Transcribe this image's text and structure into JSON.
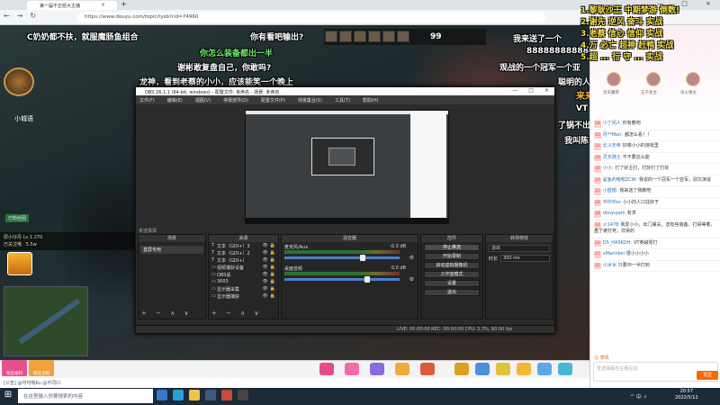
{
  "browser": {
    "tab_title": "第一届不正经大主播",
    "url": "https://www.douyu.com/topic/tysb?rid=74960",
    "tab_close": "×",
    "new_tab": "+",
    "win_controls": [
      "—",
      "□",
      "×"
    ],
    "nav_icons": [
      "←",
      "→",
      "↻"
    ]
  },
  "stream": {
    "hud_score": "99",
    "portrait_name": "小城语",
    "left_info_1": "原小仔丹 Lv 1 270",
    "left_info_2": "已关注哦 · 5.5w",
    "left_badge": "已粉丝团"
  },
  "danmaku": {
    "d1": "C奶奶都不扶，就服魔肠鱼组合",
    "d2": "你有看吧输出?",
    "d3": "你怎么装备都出一半",
    "d4": "谢彬敢复盘自己，你敢吗?",
    "d5": "龙神，看到老蔡的小小，应该能笑一个晚上",
    "d6": "我来送了一个",
    "d7": "888888888888 88",
    "d8": "观战的一个冠军一个亚",
    "d9": "聪明的人",
    "d10": "来来",
    "d11": "VT",
    "d12": "了锅不出",
    "d13": "我叫陈",
    "r1": "1.黎耿沙王 中期梦游 倒数!",
    "r2": "2.谢先 逆风 奋斗 实战",
    "r3": "3.老蔡 信心 信仰 实战",
    "r4": "4.万 必亡 超神 赶鸭 实战",
    "r5": "5.超 ... 行 守 ... 实战"
  },
  "obs": {
    "title": "OBS 26.1.1 (64-bit, windows) - 配置文件: 未命名 - 场景: 未命名",
    "menu": [
      "文件(F)",
      "编辑(E)",
      "视图(V)",
      "停靠部件(D)",
      "配置文件(P)",
      "场景集合(S)",
      "工具(T)",
      "帮助(H)"
    ],
    "title_controls": [
      "—",
      "□",
      "×"
    ],
    "scenebar": "未选择源",
    "docks": {
      "scenes": "场景",
      "sources": "来源",
      "mixer": "混音器",
      "controls": "控件",
      "transitions": "转场特效"
    },
    "scene_items": [
      "直屏专用"
    ],
    "source_items": [
      {
        "icon": "T",
        "label": "文本（GDI+）3"
      },
      {
        "icon": "T",
        "label": "文本（GDI+）2"
      },
      {
        "icon": "T",
        "label": "文本（GDI+）"
      },
      {
        "icon": "▭",
        "label": "视频捕获设备"
      },
      {
        "icon": "▭",
        "label": "OBS桌"
      },
      {
        "icon": "▭",
        "label": "3003"
      },
      {
        "icon": "▭",
        "label": "显示器采集"
      },
      {
        "icon": "▭",
        "label": "显示器捕获"
      }
    ],
    "mixer_tracks": [
      {
        "name": "麦克风/Aux",
        "db": "-0.3 dB",
        "level": 0.68
      },
      {
        "name": "桌面音频",
        "db": "0.0 dB",
        "level": 0.72
      }
    ],
    "control_buttons": [
      "停止推流",
      "开始录制",
      "启动虚拟摄像机",
      "工作室模式",
      "设置",
      "退出"
    ],
    "transitions": {
      "type": "淡出",
      "duration_label": "时长",
      "duration": "300 ms"
    },
    "status": "LIVE: 00:00:00   REC: 00:00:00   CPU: 3.3%, 60.00 fps",
    "dock_footer": "+ − ∧ ∨"
  },
  "giftbar": {
    "left_buttons": [
      "粉丝福利",
      "粉丝宝箱"
    ],
    "status_line": "[公告] @可可喂Ku @不同CI"
  },
  "chat": {
    "rank_names": [
      "灵天魔帝",
      "五千星主",
      "冰火尊主"
    ],
    "messages": [
      {
        "lv": "18",
        "user": "小丁闲人",
        "text": "你有教吧"
      },
      {
        "lv": "15",
        "user": "月**Man:",
        "text": "都怎么看！！"
      },
      {
        "lv": "22",
        "user": "北斗天帝",
        "text": "好像小小的游戏里"
      },
      {
        "lv": "20",
        "user": "灵天骑士",
        "text": "不不要这么能"
      },
      {
        "lv": "30",
        "user": "小小:",
        "text": "打了好主打，打好打了打好"
      },
      {
        "lv": "16",
        "user": "鲨鱼的嗯嗯ZCW:",
        "text": "我说的一个冠军一个亚军，别又演说"
      },
      {
        "lv": "12",
        "user": "小蓝帽:",
        "text": "我来送了我教吧"
      },
      {
        "lv": "24",
        "user": "冲冲冲sc",
        "text": "小小的人口往好于"
      },
      {
        "lv": "18",
        "user": "douyujam",
        "text": "有求"
      },
      {
        "lv": "14",
        "user": "火1478",
        "text": "我爱小小，出门屠夫，送有些装备，打闹等着，盘了被打死，非常的"
      },
      {
        "lv": "20",
        "user": "DS_HASKOH:",
        "text": "VT英磁零打"
      },
      {
        "lv": "17",
        "user": "xMarinkel",
        "text": "很小小小小"
      },
      {
        "lv": "22",
        "user": "小冰冰",
        "text": "只要冲一半打到"
      }
    ],
    "input_placeholder": "发送弹幕与主播互动",
    "send_label": "发送",
    "emoji_hint": "☺ 表情"
  },
  "taskbar": {
    "search_placeholder": "在这里输入你要搜索的内容",
    "time": "20:57",
    "date": "2022/5/12",
    "tray": "^ 中 ⚡"
  },
  "colors": {
    "danmaku_yellow": "#f4e04a",
    "danmaku_green": "#6ef26e",
    "douyu_orange": "#ff6600",
    "obs_dark": "#2b2b2b"
  }
}
